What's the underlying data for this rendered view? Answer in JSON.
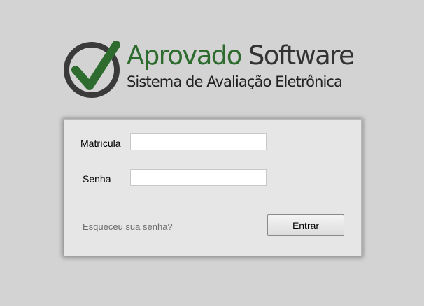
{
  "brand": {
    "title_part1": "Aprovado",
    "title_part2": " Software",
    "subtitle": "Sistema de Avaliação Eletrônica",
    "logo_icon": "checkmark-circle-icon",
    "colors": {
      "green": "#2e6b2e",
      "dark": "#333333",
      "ring": "#3a3a3a"
    }
  },
  "login_form": {
    "matricula_label": "Matrícula",
    "matricula_value": "",
    "senha_label": "Senha",
    "senha_value": "",
    "forgot_link": "Esqueceu sua senha?",
    "submit_label": "Entrar"
  }
}
